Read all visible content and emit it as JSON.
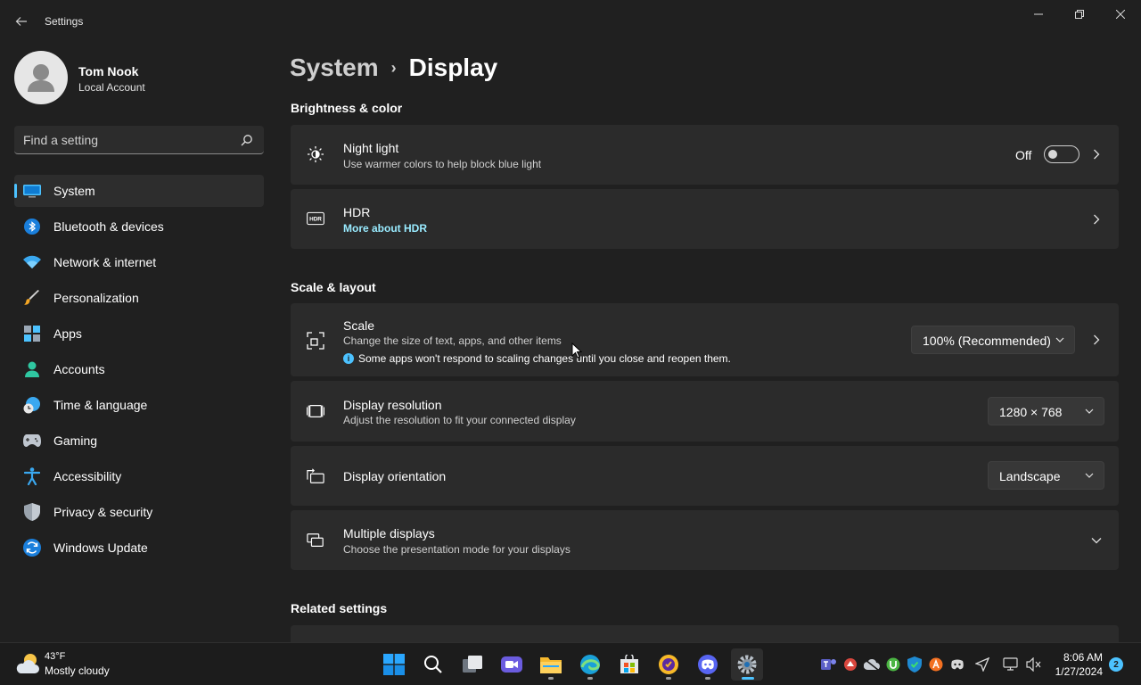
{
  "window": {
    "title": "Settings"
  },
  "profile": {
    "name": "Tom Nook",
    "account_type": "Local Account"
  },
  "search": {
    "placeholder": "Find a setting"
  },
  "sidebar": {
    "items": [
      {
        "label": "System",
        "icon": "system-icon",
        "active": true
      },
      {
        "label": "Bluetooth & devices",
        "icon": "bluetooth-icon"
      },
      {
        "label": "Network & internet",
        "icon": "wifi-icon"
      },
      {
        "label": "Personalization",
        "icon": "brush-icon"
      },
      {
        "label": "Apps",
        "icon": "apps-icon"
      },
      {
        "label": "Accounts",
        "icon": "accounts-icon"
      },
      {
        "label": "Time & language",
        "icon": "clock-globe-icon"
      },
      {
        "label": "Gaming",
        "icon": "gamepad-icon"
      },
      {
        "label": "Accessibility",
        "icon": "accessibility-icon"
      },
      {
        "label": "Privacy & security",
        "icon": "shield-icon"
      },
      {
        "label": "Windows Update",
        "icon": "update-icon"
      }
    ]
  },
  "breadcrumb": {
    "parent": "System",
    "separator": "›",
    "current": "Display"
  },
  "sections": {
    "brightness": "Brightness & color",
    "scale_layout": "Scale & layout",
    "related": "Related settings"
  },
  "night_light": {
    "title": "Night light",
    "subtitle": "Use warmer colors to help block blue light",
    "state_label": "Off"
  },
  "hdr": {
    "title": "HDR",
    "link": "More about HDR",
    "icon_text": "HDR"
  },
  "scale": {
    "title": "Scale",
    "subtitle": "Change the size of text, apps, and other items",
    "note": "Some apps won't respond to scaling changes until you close and reopen them.",
    "value": "100% (Recommended)"
  },
  "resolution": {
    "title": "Display resolution",
    "subtitle": "Adjust the resolution to fit your connected display",
    "value": "1280 × 768"
  },
  "orientation": {
    "title": "Display orientation",
    "value": "Landscape"
  },
  "multiple_displays": {
    "title": "Multiple displays",
    "subtitle": "Choose the presentation mode for your displays"
  },
  "taskbar": {
    "weather_temp": "43°F",
    "weather_desc": "Mostly cloudy",
    "time": "8:06 AM",
    "date": "1/27/2024",
    "notification_count": "2"
  },
  "colors": {
    "accent": "#4cc2ff",
    "background": "#202020",
    "card": "#2b2b2b"
  }
}
